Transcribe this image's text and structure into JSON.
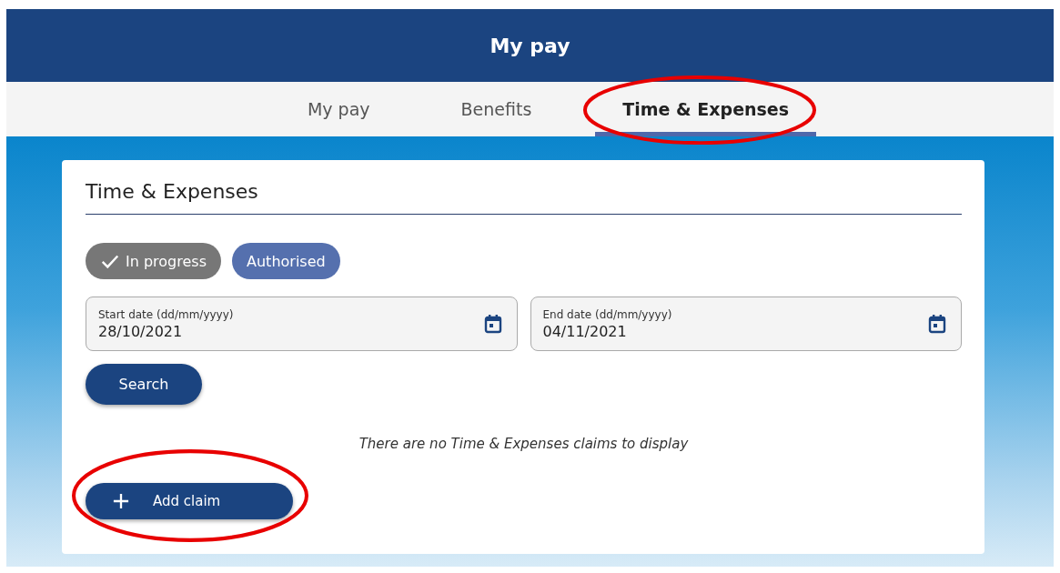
{
  "header": {
    "title": "My pay"
  },
  "tabs": [
    {
      "label": "My pay",
      "selected": false,
      "circled": false
    },
    {
      "label": "Benefits",
      "selected": false,
      "circled": false
    },
    {
      "label": "Time & Expenses",
      "selected": true,
      "circled": true
    }
  ],
  "card": {
    "title": "Time & Expenses",
    "filters": [
      {
        "label": "In progress",
        "selected": true
      },
      {
        "label": "Authorised",
        "selected": false
      }
    ],
    "date_fields": [
      {
        "label": "Start date (dd/mm/yyyy)",
        "value": "28/10/2021"
      },
      {
        "label": "End date (dd/mm/yyyy)",
        "value": "04/11/2021"
      }
    ],
    "search_button": "Search",
    "empty_message": "There are no Time & Expenses claims to display",
    "add_button": {
      "label": "Add claim",
      "circled": true
    }
  }
}
